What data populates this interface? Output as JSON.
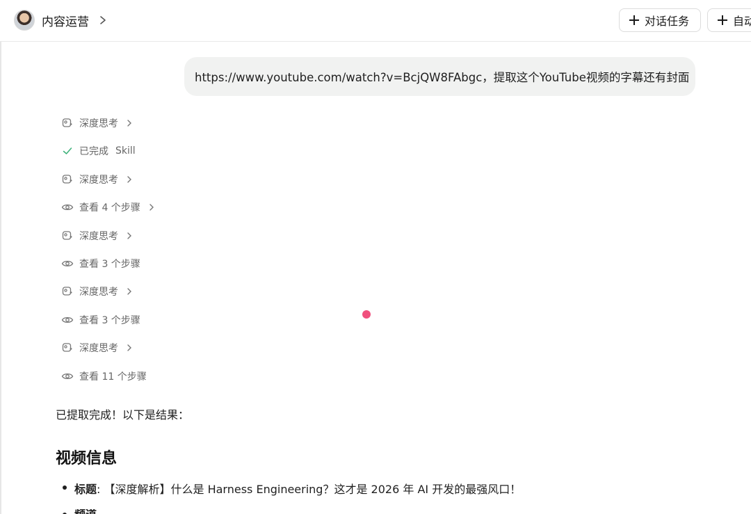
{
  "header": {
    "workspace_title": "内容运营",
    "buttons": {
      "chat_task": "对话任务",
      "auto": "自动"
    }
  },
  "conversation": {
    "user_message": "https://www.youtube.com/watch?v=BcjQW8FAbgc，提取这个YouTube视频的字幕还有封面",
    "steps": [
      {
        "type": "thinking",
        "label": "深度思考",
        "expandable": true
      },
      {
        "type": "done",
        "label": "已完成",
        "extra": "Skill",
        "expandable": false
      },
      {
        "type": "thinking",
        "label": "深度思考",
        "expandable": true
      },
      {
        "type": "view",
        "label": "查看 4 个步骤",
        "expandable": true
      },
      {
        "type": "thinking",
        "label": "深度思考",
        "expandable": true
      },
      {
        "type": "view",
        "label": "查看 3 个步骤",
        "expandable": false
      },
      {
        "type": "thinking",
        "label": "深度思考",
        "expandable": true
      },
      {
        "type": "view",
        "label": "查看 3 个步骤",
        "expandable": false
      },
      {
        "type": "thinking",
        "label": "深度思考",
        "expandable": true
      },
      {
        "type": "view",
        "label": "查看 11 个步骤",
        "expandable": false
      }
    ],
    "result_intro": "已提取完成！以下是结果：",
    "section_title": "视频信息",
    "info_items": [
      {
        "key": "标题",
        "separator": ":",
        "value": "【深度解析】什么是 Harness Engineering？这才是 2026 年 AI 开发的最强风口！"
      },
      {
        "key": "频道",
        "separator": ":",
        "value": ""
      }
    ]
  },
  "colors": {
    "accent_check": "#3cb179",
    "cursor_dot": "#f0507d",
    "bubble_bg": "#f1f2f1"
  },
  "icons": {
    "thinking": "brain-sparkle-icon",
    "done": "check-icon",
    "view": "eye-icon",
    "chevron": "chevron-right-icon",
    "add": "plus-icon"
  }
}
